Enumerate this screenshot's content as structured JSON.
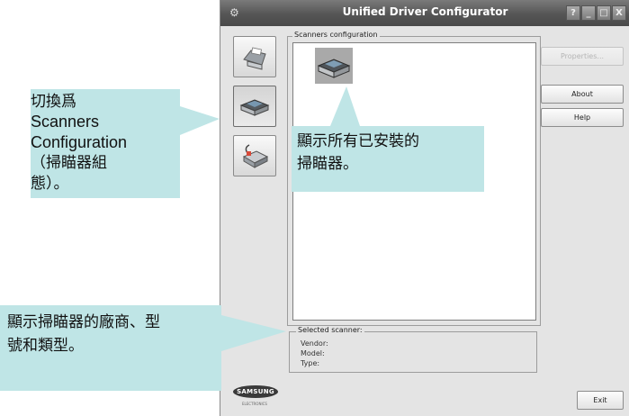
{
  "window": {
    "title": "Unified Driver Configurator",
    "controls": {
      "help": "?",
      "minimize": "_",
      "maximize": "□",
      "close": "X"
    }
  },
  "sidebar": {
    "items": [
      {
        "id": "printers",
        "icon": "printer-icon",
        "active": false
      },
      {
        "id": "scanners",
        "icon": "scanner-icon",
        "active": true
      },
      {
        "id": "ports",
        "icon": "port-icon",
        "active": false
      }
    ]
  },
  "scanners_config": {
    "label": "Scanners configuration",
    "items": [
      {
        "icon": "scanner-icon",
        "selected": true
      }
    ]
  },
  "buttons": {
    "properties": "Properties...",
    "about": "About",
    "help": "Help",
    "exit": "Exit"
  },
  "selected_scanner": {
    "label": "Selected scanner:",
    "vendor_label": "Vendor:",
    "model_label": "Model:",
    "type_label": "Type:"
  },
  "brand": {
    "logo": "SAMSUNG",
    "sub": "ELECTRONICS"
  },
  "callouts": {
    "switch": {
      "line1": "切換爲",
      "line2": "Scanners",
      "line3": "Configuration",
      "line4": "（掃瞄器組",
      "line5": "態）。"
    },
    "installed": {
      "line1": "顯示所有已安裝的",
      "line2": "掃瞄器。"
    },
    "details": {
      "line1": "顯示掃瞄器的廠商、型",
      "line2": "號和類型。"
    }
  },
  "colors": {
    "callout": "#bfe5e6",
    "titlebar": "#555555",
    "window_bg": "#e4e4e4"
  }
}
